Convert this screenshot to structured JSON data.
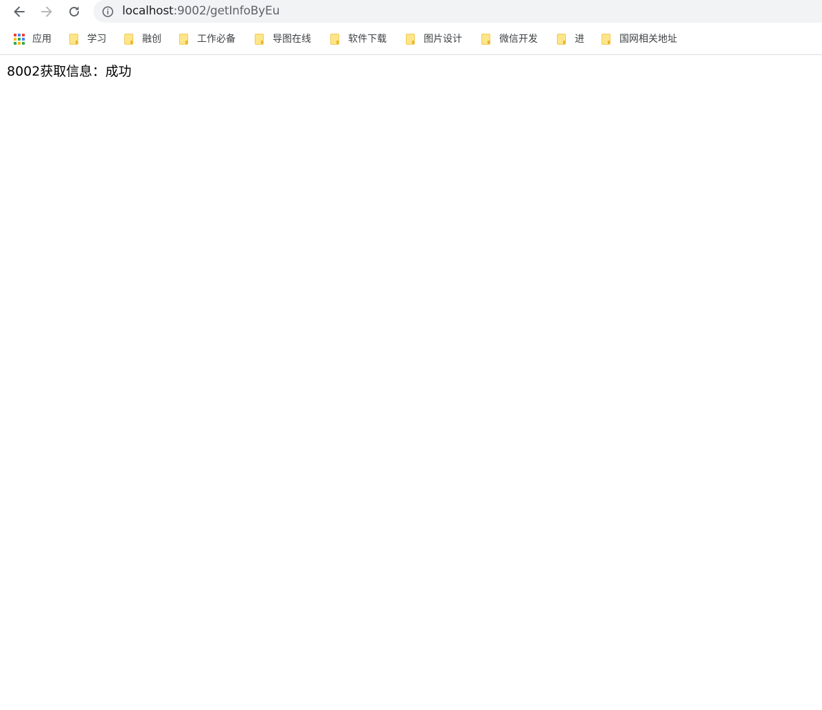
{
  "colors": {
    "omnibox_bg": "#f1f3f4",
    "folder_fill": "#fde68a",
    "divider": "#dadce0"
  },
  "toolbar": {
    "back_icon": "arrow-left-icon",
    "forward_icon": "arrow-right-icon",
    "reload_icon": "reload-icon",
    "site_info_icon": "info-circle-icon"
  },
  "address_bar": {
    "host": "localhost",
    "path": ":9002/getInfoByEu"
  },
  "bookmarks": {
    "apps_label": "应用",
    "items": [
      {
        "label": "学习",
        "icon": "folder-icon"
      },
      {
        "label": "融创",
        "icon": "folder-icon"
      },
      {
        "label": "工作必备",
        "icon": "folder-icon"
      },
      {
        "label": "导图在线",
        "icon": "folder-icon"
      },
      {
        "label": "软件下载",
        "icon": "folder-icon"
      },
      {
        "label": "图片设计",
        "icon": "folder-icon"
      },
      {
        "label": "微信开发",
        "icon": "folder-icon"
      },
      {
        "label": "进",
        "icon": "folder-icon"
      },
      {
        "label": "国网相关地址",
        "icon": "folder-icon"
      }
    ]
  },
  "page": {
    "body_text": "8002获取信息：成功"
  }
}
